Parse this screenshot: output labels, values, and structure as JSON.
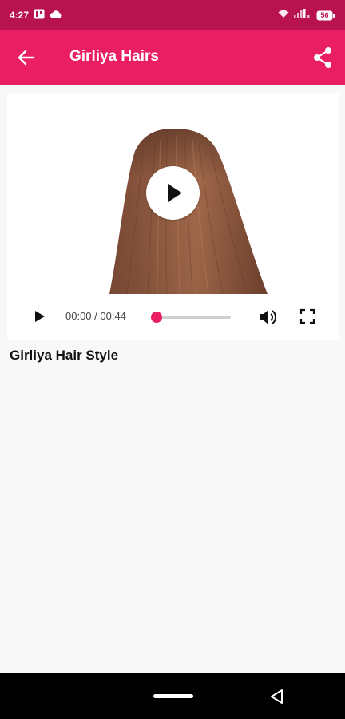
{
  "status_bar": {
    "time": "4:27",
    "battery": "56",
    "icons": [
      "sim-notification-icon",
      "cloud-icon",
      "wifi-icon",
      "signal-icon",
      "battery-icon"
    ]
  },
  "app_bar": {
    "title": "Girliya Hairs",
    "background": "#e91e63",
    "status_background": "#b8124f",
    "icons": [
      "back-arrow-icon",
      "share-icon"
    ]
  },
  "video": {
    "thumbnail": "long-straight-brown-hair-back-view",
    "time_display": "00:00 / 00:44",
    "progress": 0,
    "accent": "#e91e63"
  },
  "content": {
    "video_title": "Girliya Hair Style"
  }
}
